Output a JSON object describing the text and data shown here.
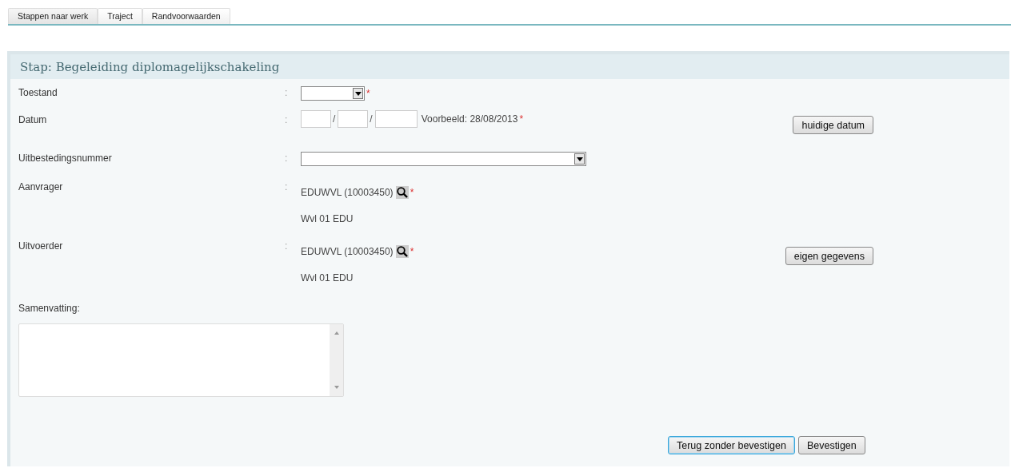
{
  "tabs": [
    {
      "label": "Stappen naar werk",
      "selected": true
    },
    {
      "label": "Traject",
      "selected": false
    },
    {
      "label": "Randvoorwaarden",
      "selected": false
    }
  ],
  "panel": {
    "title": "Stap: Begeleiding diplomagelijkschakeling",
    "fields": [
      {
        "kind": "select",
        "label": "Toestand",
        "colon": ":",
        "required_mark": "*"
      },
      {
        "kind": "date",
        "label": "Datum",
        "colon": ":",
        "date_separators": [
          "/",
          "/"
        ],
        "hint": "Voorbeeld: 28/08/2013",
        "required_mark": "*",
        "button": "huidige datum"
      },
      {
        "kind": "wideselect",
        "label": "Uitbestedingsnummer",
        "colon": ":"
      },
      {
        "kind": "person",
        "label": "Aanvrager",
        "colon": ":",
        "value": "EDUWVL (10003450)",
        "required_mark": "*",
        "detail": "Wvl 01 EDU"
      },
      {
        "kind": "person",
        "label": "Uitvoerder",
        "colon": ":",
        "value": "EDUWVL (10003450)",
        "required_mark": "*",
        "detail": "Wvl 01 EDU",
        "button": "eigen gegevens"
      }
    ],
    "summary": {
      "label": "Samenvatting:"
    },
    "actions": [
      {
        "label": "Terug zonder bevestigen",
        "focused": true
      },
      {
        "label": "Bevestigen",
        "focused": false
      }
    ]
  }
}
